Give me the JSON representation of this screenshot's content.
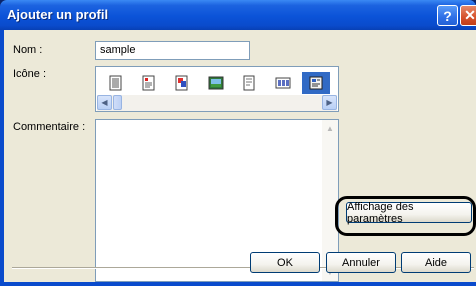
{
  "window": {
    "title": "Ajouter un profil",
    "help_glyph": "?",
    "close_glyph": "✕"
  },
  "form": {
    "name_label": "Nom :",
    "name_value": "sample",
    "icon_label": "Icône :",
    "comment_label": "Commentaire :",
    "comment_value": ""
  },
  "icons": [
    {
      "name": "document-lines-icon"
    },
    {
      "name": "document-colored-icon"
    },
    {
      "name": "document-red-icon"
    },
    {
      "name": "picture-icon"
    },
    {
      "name": "document-plain-icon"
    },
    {
      "name": "grid-document-icon"
    },
    {
      "name": "settings-document-icon",
      "selected": true
    }
  ],
  "buttons": {
    "display_settings": "Affichage des paramètres",
    "ok": "OK",
    "cancel": "Annuler",
    "help": "Aide"
  },
  "colors": {
    "title_bar": "#0a4bcc",
    "selection": "#316ac5",
    "dialog_bg": "#ece9d8"
  }
}
